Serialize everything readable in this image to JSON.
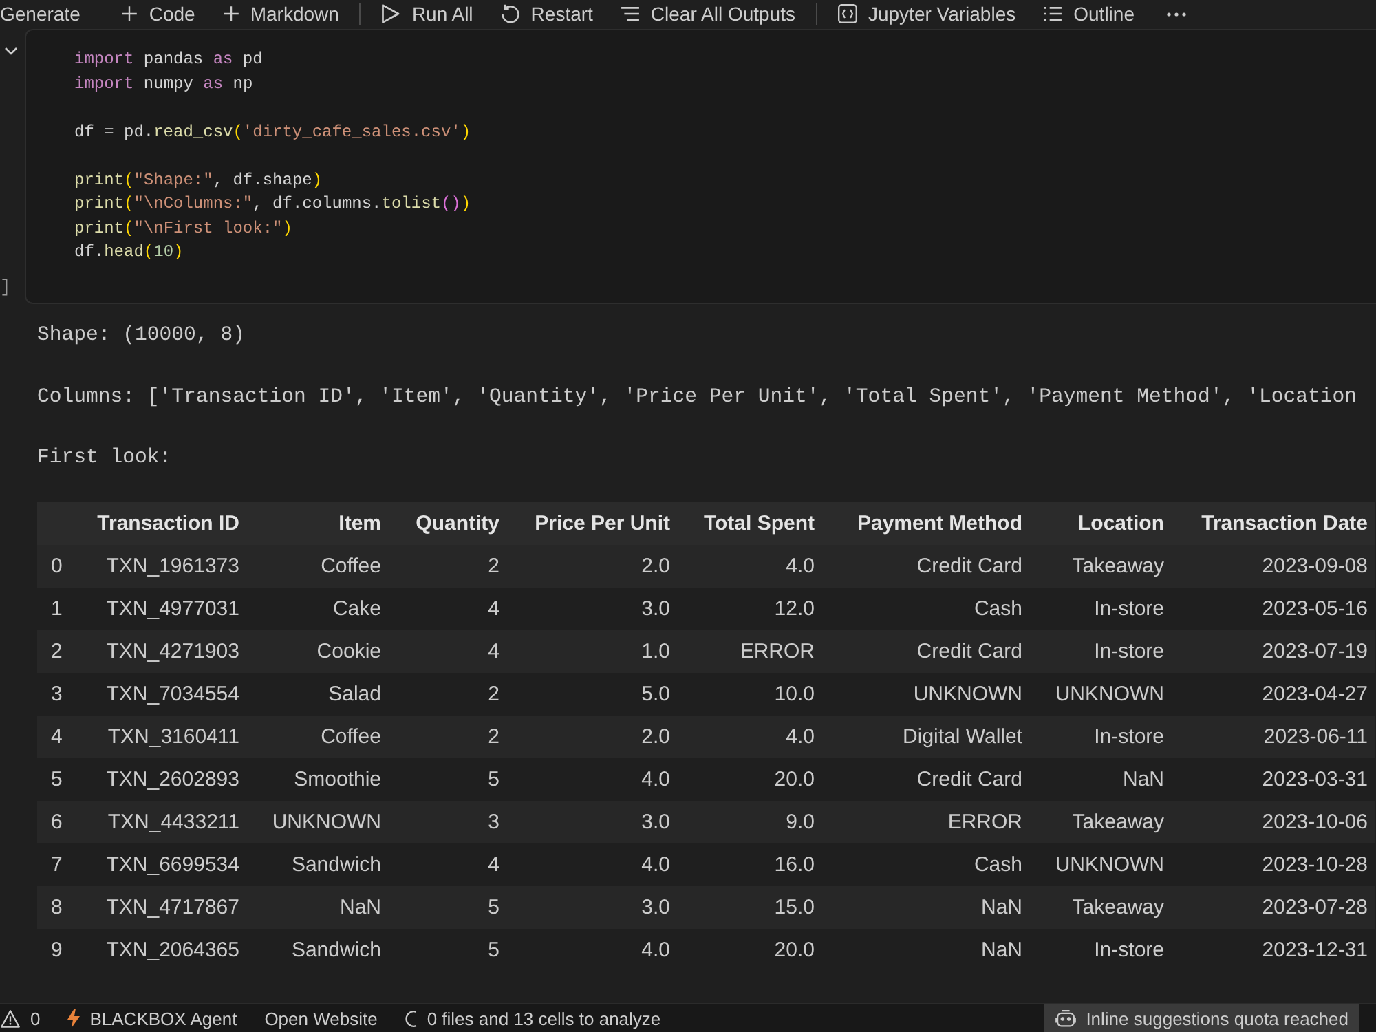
{
  "toolbar": {
    "groups": [
      [
        {
          "label": "Generate"
        },
        {
          "label": "Code"
        },
        {
          "label": "Markdown"
        }
      ],
      [
        {
          "label": "Run All"
        },
        {
          "label": "Restart"
        },
        {
          "label": "Clear All Outputs"
        }
      ],
      [
        {
          "label": "Jupyter Variables"
        },
        {
          "label": "Outline"
        }
      ]
    ]
  },
  "cell": {
    "execution_count": "]",
    "code_blocks": [
      [
        {
          "tokens": [
            {
              "kind": "keyword",
              "text": "import"
            },
            {
              "kind": "plain",
              "text": " pandas "
            },
            {
              "kind": "keyword",
              "text": "as"
            },
            {
              "kind": "plain",
              "text": " pd"
            }
          ]
        },
        {
          "tokens": [
            {
              "kind": "keyword",
              "text": "import"
            },
            {
              "kind": "plain",
              "text": " numpy "
            },
            {
              "kind": "keyword",
              "text": "as"
            },
            {
              "kind": "plain",
              "text": " np"
            }
          ]
        }
      ],
      [
        {
          "tokens": [
            {
              "kind": "plain",
              "text": "df = pd."
            },
            {
              "kind": "function",
              "text": "read_csv"
            },
            {
              "kind": "bracket1",
              "text": "("
            },
            {
              "kind": "string",
              "text": "'dirty_cafe_sales.csv'"
            },
            {
              "kind": "bracket1",
              "text": ")"
            }
          ]
        }
      ],
      [
        {
          "tokens": [
            {
              "kind": "function",
              "text": "print"
            },
            {
              "kind": "bracket1",
              "text": "("
            },
            {
              "kind": "string",
              "text": "\"Shape:\""
            },
            {
              "kind": "plain",
              "text": ", df.shape"
            },
            {
              "kind": "bracket1",
              "text": ")"
            }
          ]
        },
        {
          "tokens": [
            {
              "kind": "function",
              "text": "print"
            },
            {
              "kind": "bracket1",
              "text": "("
            },
            {
              "kind": "string",
              "text": "\"\\nColumns:\""
            },
            {
              "kind": "plain",
              "text": ", df.columns."
            },
            {
              "kind": "function",
              "text": "tolist"
            },
            {
              "kind": "bracket2",
              "text": "()"
            },
            {
              "kind": "bracket1",
              "text": ")"
            }
          ]
        },
        {
          "tokens": [
            {
              "kind": "function",
              "text": "print"
            },
            {
              "kind": "bracket1",
              "text": "("
            },
            {
              "kind": "string",
              "text": "\"\\nFirst look:\""
            },
            {
              "kind": "bracket1",
              "text": ")"
            }
          ]
        },
        {
          "tokens": [
            {
              "kind": "plain",
              "text": "df."
            },
            {
              "kind": "function",
              "text": "head"
            },
            {
              "kind": "bracket1",
              "text": "("
            },
            {
              "kind": "number",
              "text": "10"
            },
            {
              "kind": "bracket1",
              "text": ")"
            }
          ]
        }
      ]
    ]
  },
  "output": {
    "stdout": [
      "Shape: (10000, 8)",
      "Columns: ['Transaction ID', 'Item', 'Quantity', 'Price Per Unit', 'Total Spent', 'Payment Method', 'Location",
      "First look:"
    ],
    "table": {
      "columns": [
        "Transaction ID",
        "Item",
        "Quantity",
        "Price Per Unit",
        "Total Spent",
        "Payment Method",
        "Location",
        "Transaction Date"
      ],
      "rows": [
        {
          "index": "0",
          "cells": [
            "TXN_1961373",
            "Coffee",
            "2",
            "2.0",
            "4.0",
            "Credit Card",
            "Takeaway",
            "2023-09-08"
          ]
        },
        {
          "index": "1",
          "cells": [
            "TXN_4977031",
            "Cake",
            "4",
            "3.0",
            "12.0",
            "Cash",
            "In-store",
            "2023-05-16"
          ]
        },
        {
          "index": "2",
          "cells": [
            "TXN_4271903",
            "Cookie",
            "4",
            "1.0",
            "ERROR",
            "Credit Card",
            "In-store",
            "2023-07-19"
          ]
        },
        {
          "index": "3",
          "cells": [
            "TXN_7034554",
            "Salad",
            "2",
            "5.0",
            "10.0",
            "UNKNOWN",
            "UNKNOWN",
            "2023-04-27"
          ]
        },
        {
          "index": "4",
          "cells": [
            "TXN_3160411",
            "Coffee",
            "2",
            "2.0",
            "4.0",
            "Digital Wallet",
            "In-store",
            "2023-06-11"
          ]
        },
        {
          "index": "5",
          "cells": [
            "TXN_2602893",
            "Smoothie",
            "5",
            "4.0",
            "20.0",
            "Credit Card",
            "NaN",
            "2023-03-31"
          ]
        },
        {
          "index": "6",
          "cells": [
            "TXN_4433211",
            "UNKNOWN",
            "3",
            "3.0",
            "9.0",
            "ERROR",
            "Takeaway",
            "2023-10-06"
          ]
        },
        {
          "index": "7",
          "cells": [
            "TXN_6699534",
            "Sandwich",
            "4",
            "4.0",
            "16.0",
            "Cash",
            "UNKNOWN",
            "2023-10-28"
          ]
        },
        {
          "index": "8",
          "cells": [
            "TXN_4717867",
            "NaN",
            "5",
            "3.0",
            "15.0",
            "NaN",
            "Takeaway",
            "2023-07-28"
          ]
        },
        {
          "index": "9",
          "cells": [
            "TXN_2064365",
            "Sandwich",
            "5",
            "4.0",
            "20.0",
            "NaN",
            "In-store",
            "2023-12-31"
          ]
        }
      ]
    }
  },
  "status_bar": {
    "left": [
      {
        "label": "0",
        "highlighted": false
      },
      {
        "label": "BLACKBOX Agent",
        "highlighted": false
      },
      {
        "label": "Open Website",
        "highlighted": false
      },
      {
        "label": "0 files and 13 cells to analyze",
        "highlighted": false
      }
    ],
    "right": [
      {
        "label": "Inline suggestions quota reached",
        "highlighted": true
      }
    ]
  }
}
